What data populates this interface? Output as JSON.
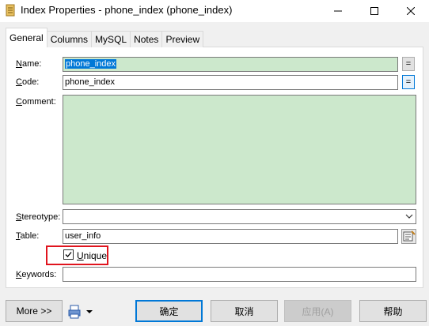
{
  "window": {
    "title": "Index Properties - phone_index (phone_index)",
    "controls": {
      "minimize": "—",
      "maximize": "☐",
      "close": "✕"
    }
  },
  "tabs": [
    {
      "label": "General",
      "active": true
    },
    {
      "label": "Columns",
      "active": false
    },
    {
      "label": "MySQL",
      "active": false
    },
    {
      "label": "Notes",
      "active": false
    },
    {
      "label": "Preview",
      "active": false
    }
  ],
  "form": {
    "name": {
      "label_first": "N",
      "label_rest": "ame:",
      "value": "phone_index"
    },
    "code": {
      "label_first": "C",
      "label_rest": "ode:",
      "value": "phone_index"
    },
    "comment": {
      "label_first": "C",
      "label_rest": "omment:",
      "value": ""
    },
    "stereotype": {
      "label_first": "S",
      "label_rest": "tereotype:",
      "value": ""
    },
    "table": {
      "label_first": "T",
      "label_rest": "able:",
      "value": "user_info"
    },
    "unique": {
      "label_first": "U",
      "label_rest": "nique",
      "checked": true
    },
    "keywords": {
      "label_first": "K",
      "label_rest": "eywords:",
      "value": ""
    },
    "eq_symbol": "="
  },
  "buttons": {
    "more": "More >>",
    "ok": "确定",
    "cancel": "取消",
    "apply": "应用(A)",
    "help": "帮助"
  },
  "colors": {
    "name_highlight": "#cce8cc",
    "selection": "#0078d7",
    "annotation_box": "#e0141e"
  }
}
